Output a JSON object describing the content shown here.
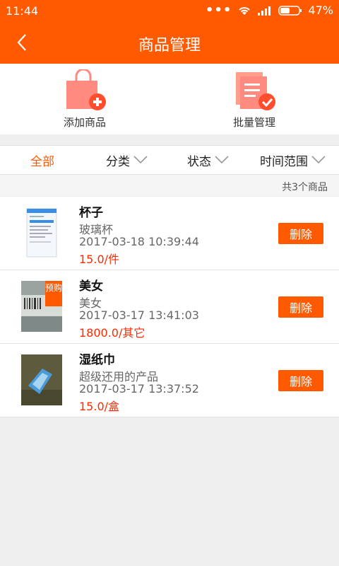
{
  "status": {
    "time": "11:44",
    "battery": "47%"
  },
  "header": {
    "title": "商品管理"
  },
  "actions": {
    "add_label": "添加商品",
    "batch_label": "批量管理"
  },
  "filters": [
    {
      "label": "全部"
    },
    {
      "label": "分类"
    },
    {
      "label": "状态"
    },
    {
      "label": "时间范围"
    }
  ],
  "count_text": "共3个商品",
  "products": [
    {
      "name": "杯子",
      "desc": "玻璃杯",
      "date": "2017-03-18 10:39:44",
      "price": "15.0/件",
      "delete_label": "删除"
    },
    {
      "name": "美女",
      "desc": "美女",
      "date": "2017-03-17 13:41:03",
      "price": "1800.0/其它",
      "delete_label": "删除",
      "tag": "预购"
    },
    {
      "name": "湿纸巾",
      "desc": "超级还用的产品",
      "date": "2017-03-17 13:37:52",
      "price": "15.0/盒",
      "delete_label": "删除"
    }
  ],
  "colors": {
    "accent": "#ff5a00",
    "price": "#ff2a00"
  }
}
